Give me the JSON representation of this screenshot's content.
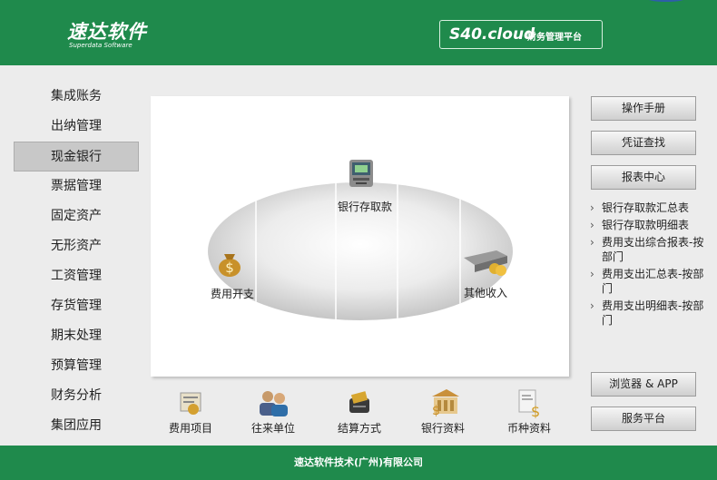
{
  "header": {
    "logo_text": "速达软件",
    "logo_subtitle": "Superdata Software",
    "product_brand": "S40.cloud",
    "product_title": "财务管理平台"
  },
  "nav": {
    "items": [
      "集成账务",
      "出纳管理",
      "现金银行",
      "票据管理",
      "固定资产",
      "无形资产",
      "工资管理",
      "存货管理",
      "期末处理",
      "预算管理",
      "财务分析",
      "集团应用"
    ],
    "active": "现金银行"
  },
  "hub": {
    "top": "银行存取款",
    "left": "费用开支",
    "right": "其他收入"
  },
  "quick_links": [
    "费用项目",
    "往来单位",
    "结算方式",
    "银行资料",
    "币种资料"
  ],
  "right_panel": {
    "manual": "操作手册",
    "voucher": "凭证查找",
    "report_center": "报表中心",
    "reports": [
      "银行存取款汇总表",
      "银行存取款明细表",
      "费用支出综合报表-按部门",
      "费用支出汇总表-按部门",
      "费用支出明细表-按部门"
    ],
    "browser_app": "浏览器 & APP",
    "service": "服务平台"
  },
  "footer": {
    "company": "速达软件技术(广州)有限公司"
  },
  "colors": {
    "brand_green": "#1f8a4c",
    "panel_bg": "#ffffff",
    "page_bg": "#ececec"
  },
  "icons": {
    "top": "atm-icon",
    "left": "money-bag-icon",
    "right": "cash-register-icon",
    "quick": [
      "expense-item-icon",
      "contacts-icon",
      "card-swipe-icon",
      "bank-icon",
      "currency-document-icon"
    ]
  }
}
